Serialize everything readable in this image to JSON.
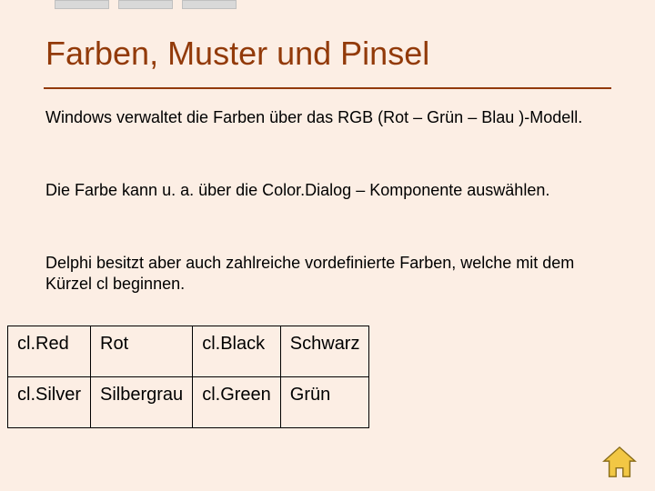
{
  "title": "Farben, Muster und Pinsel",
  "paragraphs": {
    "p1": "Windows verwaltet die Farben über das RGB (Rot – Grün – Blau )-Modell.",
    "p2": "Die Farbe kann u. a. über die Color.Dialog – Komponente auswählen.",
    "p3": "Delphi besitzt aber auch zahlreiche vordefinierte Farben, welche mit dem Kürzel cl beginnen."
  },
  "table": {
    "rows": [
      {
        "c1": "cl.Red",
        "c2": "Rot",
        "c3": "cl.Black",
        "c4": "Schwarz"
      },
      {
        "c1": "cl.Silver",
        "c2": "Silbergrau",
        "c3": "cl.Green",
        "c4": "Grün"
      }
    ]
  },
  "colors": {
    "background": "#fceee4",
    "accent": "#923a09",
    "tab": "#d9d9d9",
    "homeFill": "#f2c744",
    "homeStroke": "#8a6d1a"
  }
}
